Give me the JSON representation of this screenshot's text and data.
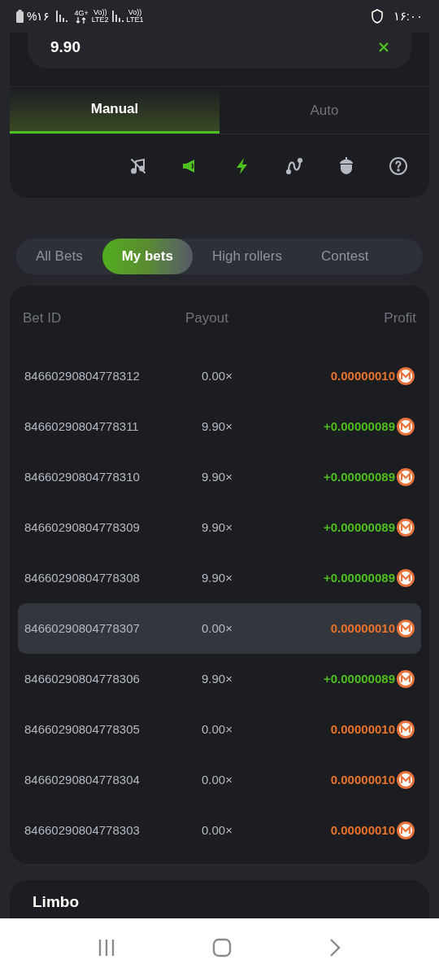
{
  "status_bar": {
    "battery": "%۱۶",
    "network_1": "4G+",
    "volte_1": "Vo))",
    "lte_1": "LTE2",
    "volte_2": "Vo))",
    "lte_2": "LTE1",
    "time": "۱۶:۰۰"
  },
  "bet_card": {
    "payout_value": "9.90",
    "mode_tabs": [
      {
        "label": "Manual",
        "selected": true
      },
      {
        "label": "Auto",
        "selected": false
      }
    ],
    "tools": [
      {
        "kind": "music",
        "on": false
      },
      {
        "kind": "horn",
        "on": true
      },
      {
        "kind": "bolt",
        "on": true
      },
      {
        "kind": "curve",
        "on": false
      },
      {
        "kind": "acorn",
        "on": false
      },
      {
        "kind": "help",
        "on": false
      }
    ]
  },
  "bet_tabs": [
    {
      "label": "All Bets",
      "selected": false
    },
    {
      "label": "My bets",
      "selected": true
    },
    {
      "label": "High rollers",
      "selected": false
    },
    {
      "label": "Contest",
      "selected": false
    }
  ],
  "table": {
    "columns": [
      "Bet ID",
      "Payout",
      "Profit"
    ],
    "rows": [
      {
        "bet_id": "84660290804778312",
        "payout": "0.00×",
        "profit": "0.00000010",
        "kind": "loss",
        "selected": false
      },
      {
        "bet_id": "84660290804778311",
        "payout": "9.90×",
        "profit": "+0.00000089",
        "kind": "win",
        "selected": false
      },
      {
        "bet_id": "84660290804778310",
        "payout": "9.90×",
        "profit": "+0.00000089",
        "kind": "win",
        "selected": false
      },
      {
        "bet_id": "84660290804778309",
        "payout": "9.90×",
        "profit": "+0.00000089",
        "kind": "win",
        "selected": false
      },
      {
        "bet_id": "84660290804778308",
        "payout": "9.90×",
        "profit": "+0.00000089",
        "kind": "win",
        "selected": false
      },
      {
        "bet_id": "84660290804778307",
        "payout": "0.00×",
        "profit": "0.00000010",
        "kind": "loss",
        "selected": true
      },
      {
        "bet_id": "84660290804778306",
        "payout": "9.90×",
        "profit": "+0.00000089",
        "kind": "win",
        "selected": false
      },
      {
        "bet_id": "84660290804778305",
        "payout": "0.00×",
        "profit": "0.00000010",
        "kind": "loss",
        "selected": false
      },
      {
        "bet_id": "84660290804778304",
        "payout": "0.00×",
        "profit": "0.00000010",
        "kind": "loss",
        "selected": false
      },
      {
        "bet_id": "84660290804778303",
        "payout": "0.00×",
        "profit": "0.00000010",
        "kind": "loss",
        "selected": false
      }
    ]
  },
  "game_card": {
    "title": "Limbo"
  }
}
